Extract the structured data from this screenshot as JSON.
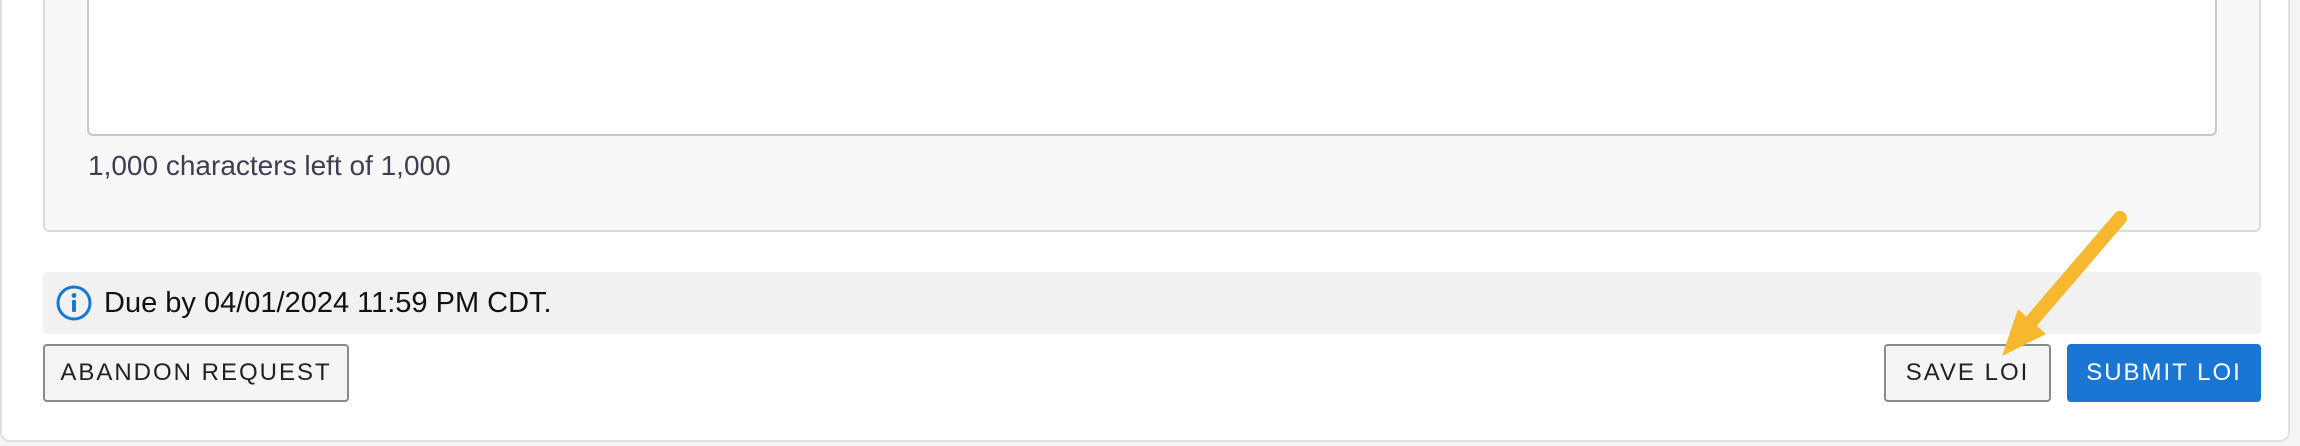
{
  "comment_section": {
    "textarea_value": "",
    "char_count_text": "1,000 characters left of 1,000"
  },
  "due_notice": {
    "icon": "info-icon",
    "text": "Due by 04/01/2024 11:59 PM CDT."
  },
  "actions": {
    "abandon_label": "ABANDON REQUEST",
    "save_label": "SAVE LOI",
    "submit_label": "SUBMIT LOI"
  },
  "annotation": {
    "icon": "arrow-pointer-icon",
    "color": "#f5b82e"
  },
  "colors": {
    "primary": "#1976d2",
    "info_icon": "#1976d2",
    "arrow": "#f5b82e"
  }
}
